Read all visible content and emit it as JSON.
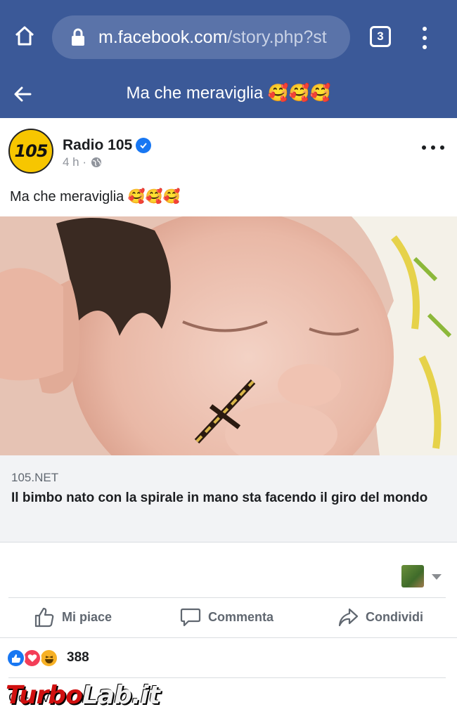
{
  "browser": {
    "url_host": "m.facebook.com",
    "url_path": "/story.php?st",
    "tab_count": "3",
    "icons": [
      "home-icon",
      "lock-icon",
      "tabs-icon",
      "overflow-menu-icon"
    ]
  },
  "header": {
    "title": "Ma che meraviglia 🥰🥰🥰",
    "back_icon": "arrow-left-icon"
  },
  "post": {
    "page_name": "Radio 105",
    "avatar_text": "105",
    "time": "4 h ·",
    "text": "Ma che meraviglia 🥰🥰🥰",
    "image_alt": "newborn baby holding IUD"
  },
  "link_card": {
    "domain": "105.NET",
    "title": "Il bimbo nato con la spirale in mano sta facendo il giro del mondo"
  },
  "actions": {
    "like": "Mi piace",
    "comment": "Commenta",
    "share": "Condividi"
  },
  "reactions": {
    "count": "388",
    "types": [
      "like",
      "love",
      "haha"
    ]
  },
  "comments": {
    "partial_text": "Co·· ·v",
    "watermark_a": "Turbo",
    "watermark_b": "Lab.it"
  },
  "colors": {
    "brand": "#3b5998",
    "like": "#1877f2",
    "love": "#f33e58",
    "haha": "#f7b125"
  }
}
